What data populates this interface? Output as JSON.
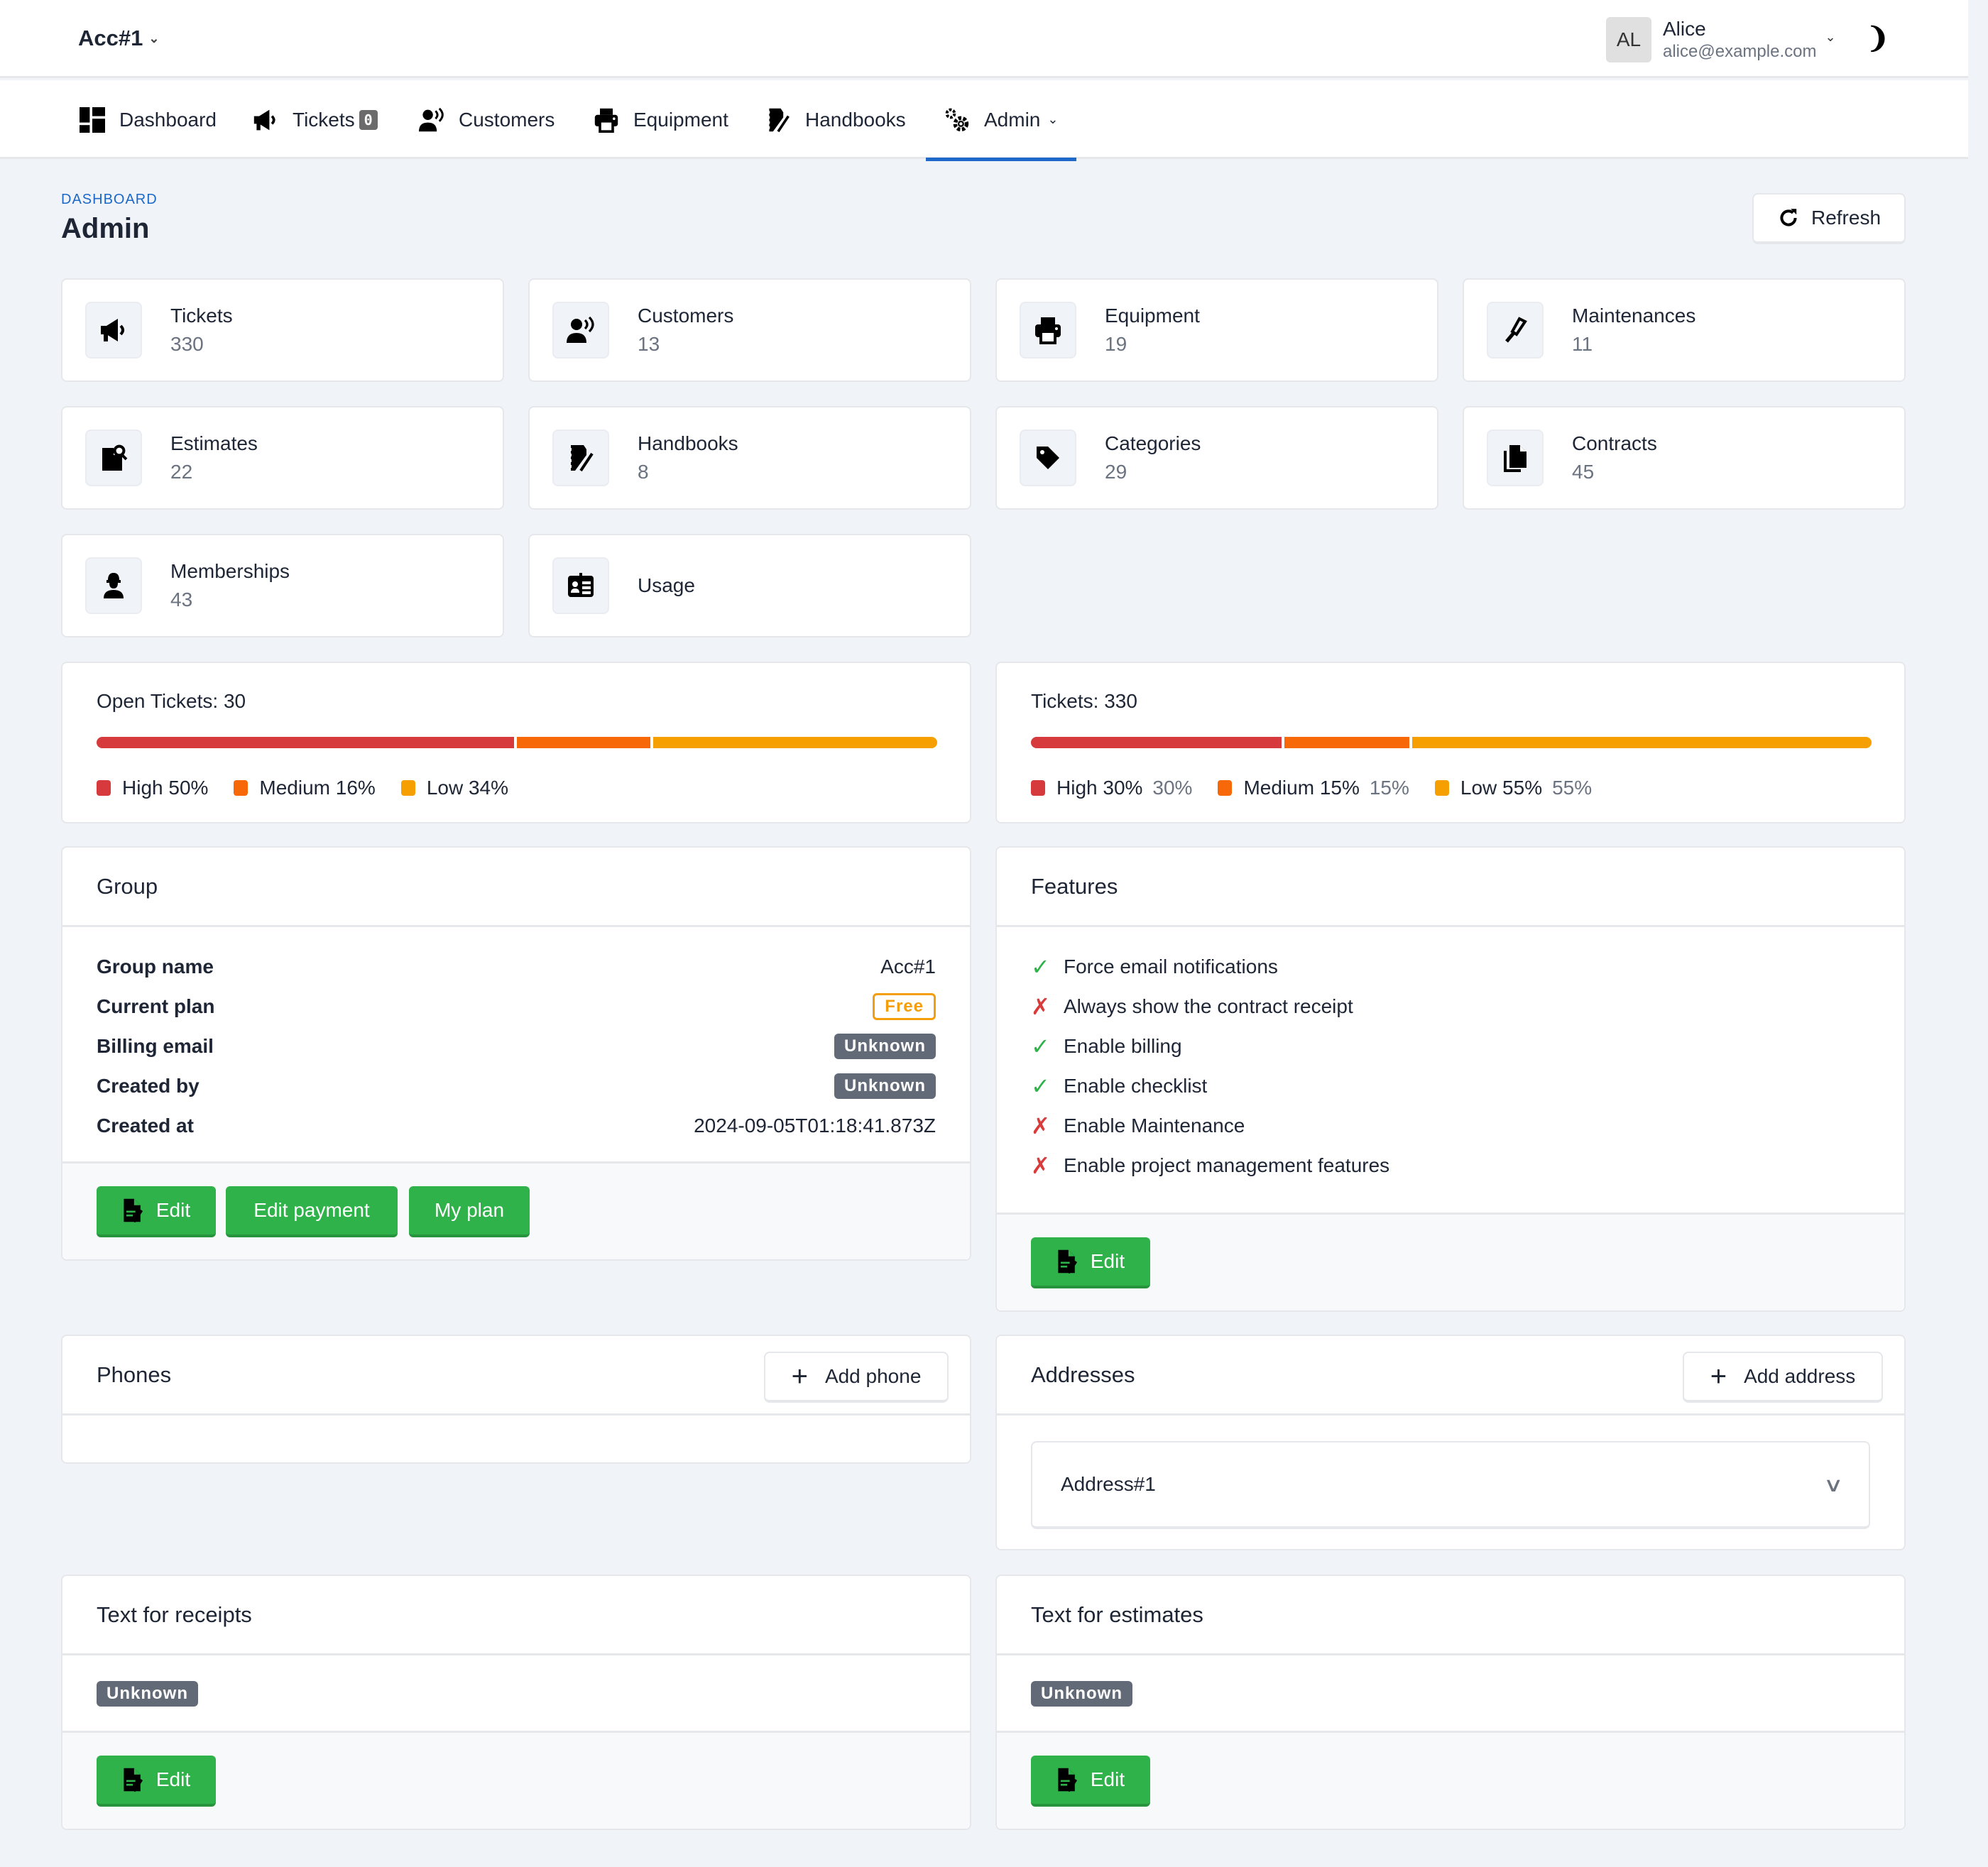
{
  "topbar": {
    "account": "Acc#1",
    "user": {
      "initials": "AL",
      "name": "Alice",
      "email": "alice@example.com"
    },
    "theme_icon": "moon-icon"
  },
  "nav": [
    {
      "label": "Dashboard",
      "icon": "dashboard-icon"
    },
    {
      "label": "Tickets",
      "icon": "megaphone-icon",
      "badge": "0"
    },
    {
      "label": "Customers",
      "icon": "customer-voice-icon"
    },
    {
      "label": "Equipment",
      "icon": "printer-icon"
    },
    {
      "label": "Handbooks",
      "icon": "handbook-icon"
    },
    {
      "label": "Admin",
      "icon": "gears-icon",
      "active": true
    }
  ],
  "page": {
    "breadcrumb": "DASHBOARD",
    "title": "Admin",
    "refresh_label": "Refresh"
  },
  "stats": [
    {
      "label": "Tickets",
      "value": "330",
      "icon": "megaphone-icon"
    },
    {
      "label": "Customers",
      "value": "13",
      "icon": "customer-voice-icon"
    },
    {
      "label": "Equipment",
      "value": "19",
      "icon": "printer-icon"
    },
    {
      "label": "Maintenances",
      "value": "11",
      "icon": "screwdriver-icon"
    },
    {
      "label": "Estimates",
      "value": "22",
      "icon": "file-search-icon"
    },
    {
      "label": "Handbooks",
      "value": "8",
      "icon": "handbook-icon"
    },
    {
      "label": "Categories",
      "value": "29",
      "icon": "tag-icon"
    },
    {
      "label": "Contracts",
      "value": "45",
      "icon": "copy-file-icon"
    },
    {
      "label": "Memberships",
      "value": "43",
      "icon": "worker-icon"
    },
    {
      "label": "Usage",
      "value": null,
      "icon": "id-card-icon"
    }
  ],
  "open_tickets": {
    "title": "Open Tickets: 30",
    "segments": [
      {
        "label": "High 50%",
        "pct": 50,
        "color": "#d63a3c"
      },
      {
        "label": "Medium 16%",
        "pct": 16,
        "color": "#f76808"
      },
      {
        "label": "Low 34%",
        "pct": 34,
        "color": "#f5a000"
      }
    ]
  },
  "all_tickets": {
    "title": "Tickets: 330",
    "segments": [
      {
        "label": "High 30%",
        "extra": "30%",
        "pct": 30,
        "color": "#d63a3c"
      },
      {
        "label": "Medium 15%",
        "extra": "15%",
        "pct": 15,
        "color": "#f76808"
      },
      {
        "label": "Low 55%",
        "extra": "55%",
        "pct": 55,
        "color": "#f5a000"
      }
    ]
  },
  "group": {
    "title": "Group",
    "rows": [
      {
        "key": "Group name",
        "value": "Acc#1",
        "type": "text"
      },
      {
        "key": "Current plan",
        "value": "Free",
        "type": "free"
      },
      {
        "key": "Billing email",
        "value": "Unknown",
        "type": "unknown"
      },
      {
        "key": "Created by",
        "value": "Unknown",
        "type": "unknown"
      },
      {
        "key": "Created at",
        "value": "2024-09-05T01:18:41.873Z",
        "type": "text"
      }
    ],
    "buttons": {
      "edit": "Edit",
      "edit_payment": "Edit payment",
      "my_plan": "My plan"
    }
  },
  "features": {
    "title": "Features",
    "items": [
      {
        "label": "Force email notifications",
        "enabled": true
      },
      {
        "label": "Always show the contract receipt",
        "enabled": false
      },
      {
        "label": "Enable billing",
        "enabled": true
      },
      {
        "label": "Enable checklist",
        "enabled": true
      },
      {
        "label": "Enable Maintenance",
        "enabled": false
      },
      {
        "label": "Enable project management features",
        "enabled": false
      }
    ],
    "edit_label": "Edit"
  },
  "phones": {
    "title": "Phones",
    "add_label": "Add phone"
  },
  "addresses": {
    "title": "Addresses",
    "add_label": "Add address",
    "items": [
      "Address#1"
    ]
  },
  "receipts": {
    "title": "Text for receipts",
    "value": "Unknown",
    "edit_label": "Edit"
  },
  "estimates": {
    "title": "Text for estimates",
    "value": "Unknown",
    "edit_label": "Edit"
  },
  "marks": {
    "check": "✓",
    "cross": "✗",
    "plus": "+",
    "chevron": "⌄",
    "moon": ")"
  }
}
